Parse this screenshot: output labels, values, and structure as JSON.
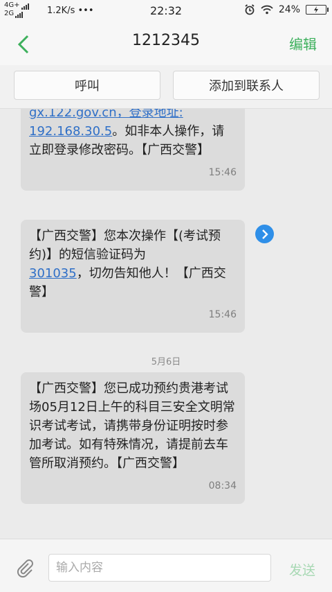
{
  "status_bar": {
    "net_top": "4G+",
    "net_bottom": "2G",
    "speed": "1.2K/s",
    "time": "22:32",
    "battery": "24%"
  },
  "header": {
    "title": "1212345",
    "edit_label": "编辑"
  },
  "actions": {
    "call_label": "呼叫",
    "add_contact_label": "添加到联系人"
  },
  "messages": [
    {
      "line1": "gx.122.gov.cn，登录地址:",
      "link": "192.168.30.5",
      "rest": "。如非本人操作，请立即登录修改密码。【广西交警】",
      "time": "15:46"
    },
    {
      "before": "【广西交警】您本次操作【(考试预约)】的短信验证码为",
      "link": "301035",
      "after": "，切勿告知他人！【广西交警】",
      "time": "15:46"
    },
    {
      "text": "【广西交警】您已成功预约贵港考试场05月12日上午的科目三安全文明常识考试考试，请携带身份证明按时参加考试。如有特殊情况，请提前去车管所取消预约。【广西交警】",
      "time": "08:34"
    }
  ],
  "date_separator": "5月6日",
  "composer": {
    "placeholder": "输入内容",
    "send_label": "发送"
  },
  "colors": {
    "accent": "#3db05c",
    "link": "#2f6fc7",
    "bubble": "#dcdcdc",
    "info_button": "#2f8fe8"
  }
}
